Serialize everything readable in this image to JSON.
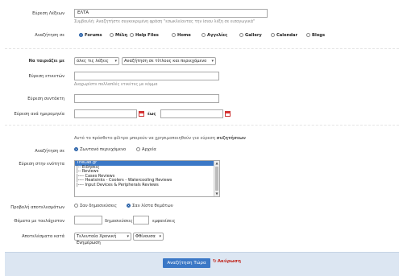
{
  "keywords": {
    "label": "Εύρεση Λέξεων",
    "value": "ΕΛΤΑ",
    "hint": "Συμβουλή: Αναζητήστε συγκεκριμένη φράση \"εσωκλείοντας την ίσιου λέξη σε εισαγωγικά\""
  },
  "search_in": {
    "label": "Αναζήτηση σε",
    "options": [
      "Forums",
      "Μέλη",
      "Help Files",
      "Home",
      "Αγγελίες",
      "Gallery",
      "Calendar",
      "Blogs"
    ],
    "selected": "Forums"
  },
  "sort": {
    "label": "Να ταιριάζει με",
    "match_value": "όλες τις λέξεις",
    "scope_value": "Αναζήτηση σε τίτλους και περιεχόμενο"
  },
  "tags": {
    "label": "Εύρεση ετικετών",
    "hint": "Διαχωρίστε πολλαπλές ετικέτες με κόμμα"
  },
  "author": {
    "label": "Εύρεση συντάκτη"
  },
  "date": {
    "label": "Εύρεση ανά ημερομηνία",
    "to_label": "έως"
  },
  "filter_note": {
    "text": "Αυτό το πρόσθετο φίλτρο μπορούν να χρησιμοποιηθούν για εύρεση",
    "bold": "συζητήσεων"
  },
  "search_where": {
    "label": "Αναζήτηση σε",
    "options": [
      "Ζωντανό περιεχόμενο",
      "Αρχεία"
    ],
    "selected": "Ζωντανό περιεχόμενο"
  },
  "forum_select": {
    "label": "Εύρεση στην ενότητα",
    "items": [
      "TheLab.gr",
      "|-- Ειδήσεις",
      "|-- Reviews",
      "|---- Cases Reviews",
      "|---- Heatsinks - Coolers - Watercooling Reviews",
      "|---- Input Devices & Peripherals Reviews"
    ],
    "selected": "TheLab.gr"
  },
  "display": {
    "label": "Προβολή αποτελεσμάτων",
    "options": [
      "Σαν δημοσιεύσεις",
      "Σαν λίστα θεμάτων"
    ],
    "selected": "Σαν λίστα θεμάτων"
  },
  "min_topics": {
    "label": "Θέματα με τουλάχιστον",
    "mid": "δημοσιεύσεις και",
    "end": "εμφανίσεις"
  },
  "results_order": {
    "label": "Αποτελέσματα κατά",
    "sort_value": "Τελευταία Χρονική Ενημέρωση",
    "dir_value": "Φθίνουσα"
  },
  "actions": {
    "submit": "Αναζήτηση Τώρα",
    "reset": "Ακύρωση"
  },
  "colors": {
    "accent": "#3b78c6",
    "footer": "#dce6f2",
    "reset": "#c0281f"
  }
}
